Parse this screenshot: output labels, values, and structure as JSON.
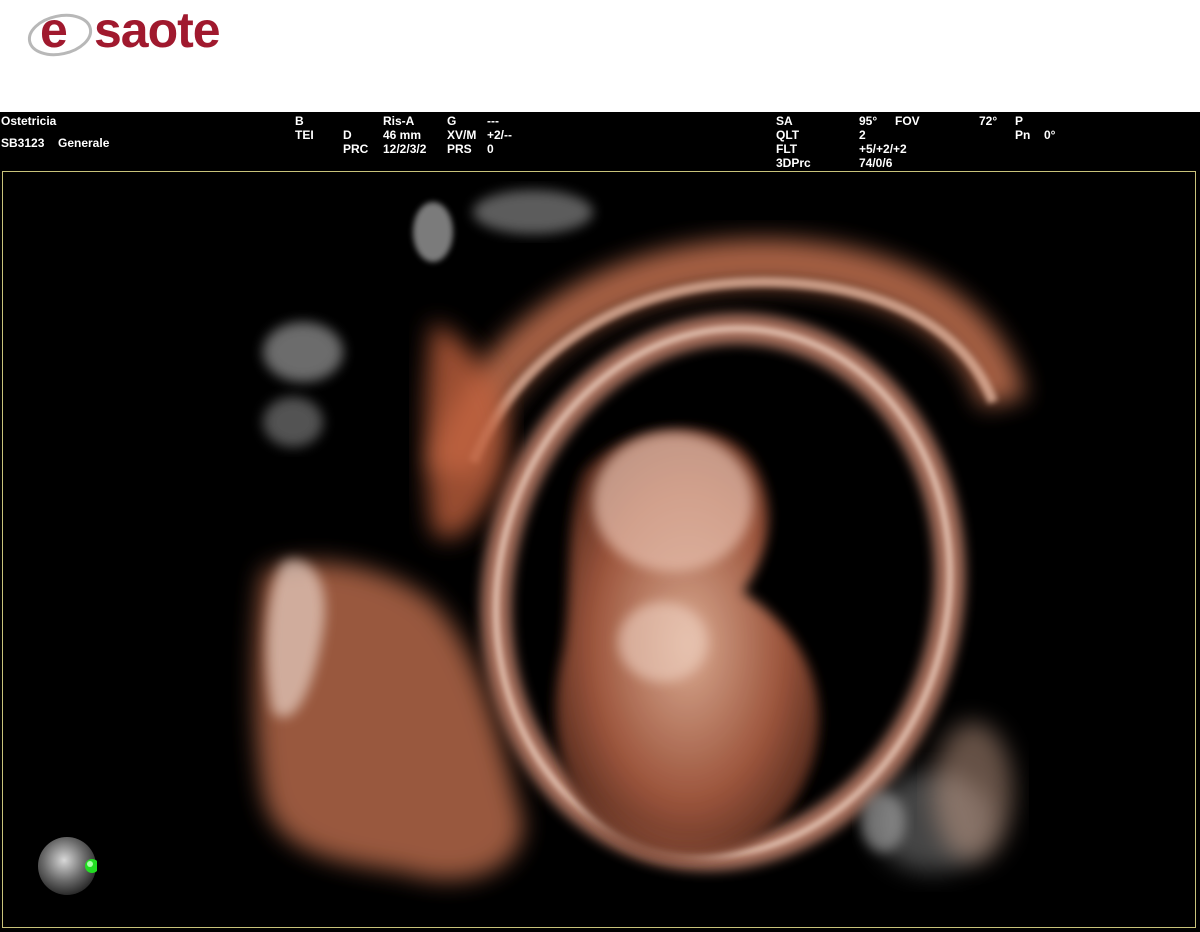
{
  "brand": {
    "logo_letter": "e",
    "logo_rest": "saote",
    "color": "#a0192e"
  },
  "header": {
    "exam": "Ostetricia",
    "probe": "SB3123",
    "preset": "Generale",
    "col1": {
      "b": "B",
      "tei": "TEI"
    },
    "col2": {
      "d": "D",
      "prc": "PRC"
    },
    "col3": {
      "ris": "Ris-A",
      "depth": "46 mm",
      "prc_val": "12/2/3/2"
    },
    "col4": {
      "g": "G",
      "xvm": "XV/M",
      "prs": "PRS"
    },
    "col5": {
      "g_val": "---",
      "xvm_val": "+2/--",
      "prs_val": "0"
    },
    "col6": {
      "sa": "SA",
      "qlt": "QLT",
      "flt": "FLT",
      "prc3d": "3DPrc"
    },
    "col7": {
      "sa_val": "95°",
      "qlt_val": "2",
      "flt_val": "+5/+2/+2",
      "prc3d_val": "74/0/6"
    },
    "col8": {
      "fov": "FOV"
    },
    "col9": {
      "fov_val": "72°"
    },
    "col10": {
      "p": "P",
      "pn": "Pn"
    },
    "col11": {
      "pn_val": "0°"
    }
  },
  "colors": {
    "frame_border": "#c8c27a",
    "orientation_marker": "#22dd22",
    "tissue": "#c98a6e"
  },
  "icons": {
    "orientation": "orientation-sphere-icon"
  }
}
